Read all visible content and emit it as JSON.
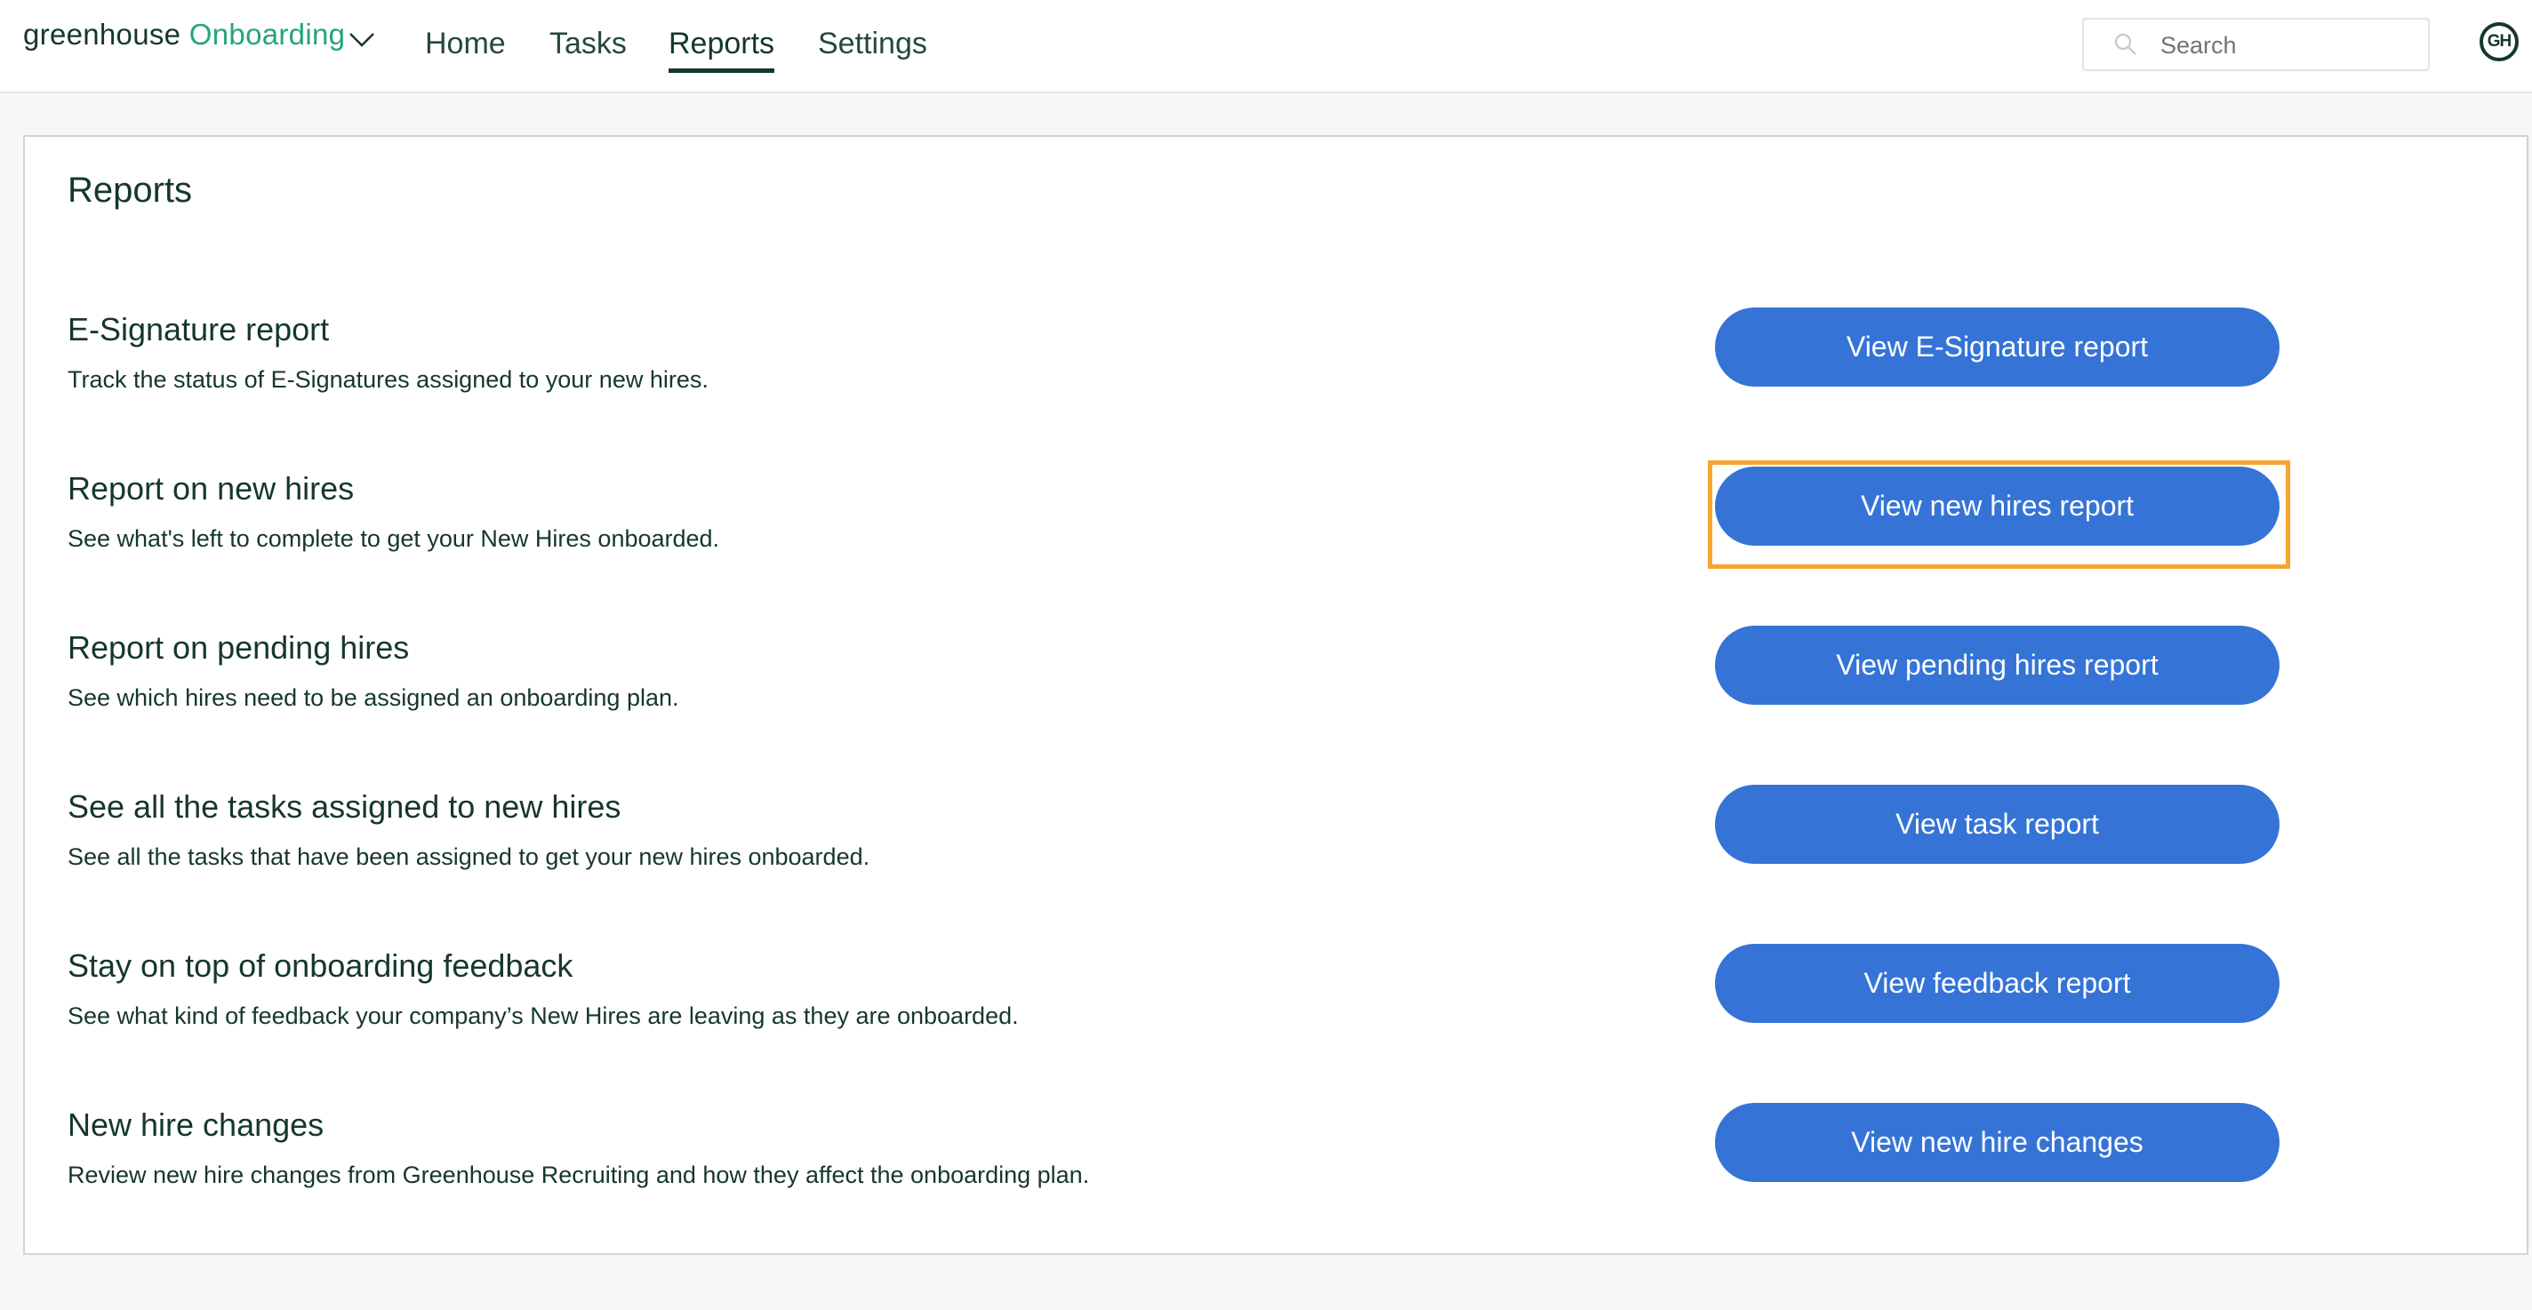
{
  "header": {
    "logo_brand": "greenhouse",
    "logo_product": "Onboarding",
    "nav": [
      {
        "label": "Home",
        "active": false
      },
      {
        "label": "Tasks",
        "active": false
      },
      {
        "label": "Reports",
        "active": true
      },
      {
        "label": "Settings",
        "active": false
      }
    ],
    "search": {
      "placeholder": "Search",
      "value": "",
      "icon": "search-icon"
    },
    "avatar_initials": "GH"
  },
  "main": {
    "title": "Reports",
    "reports": [
      {
        "title": "E-Signature report",
        "description": "Track the status of E-Signatures assigned to your new hires.",
        "button": "View E-Signature report",
        "highlighted": false
      },
      {
        "title": "Report on new hires",
        "description": "See what's left to complete to get your New Hires onboarded.",
        "button": "View new hires report",
        "highlighted": true
      },
      {
        "title": "Report on pending hires",
        "description": "See which hires need to be assigned an onboarding plan.",
        "button": "View pending hires report",
        "highlighted": false
      },
      {
        "title": "See all the tasks assigned to new hires",
        "description": "See all the tasks that have been assigned to get your new hires onboarded.",
        "button": "View task report",
        "highlighted": false
      },
      {
        "title": "Stay on top of onboarding feedback",
        "description": "See what kind of feedback your company’s New Hires are leaving as they are onboarded.",
        "button": "View feedback report",
        "highlighted": false
      },
      {
        "title": "New hire changes",
        "description": "Review new hire changes from Greenhouse Recruiting and how they affect the onboarding plan.",
        "button": "View new hire changes",
        "highlighted": false
      }
    ]
  },
  "colors": {
    "brand_dark": "#15372c",
    "brand_green": "#24a47f",
    "button_blue": "#3574d6",
    "highlight_orange": "#f8a52d"
  }
}
